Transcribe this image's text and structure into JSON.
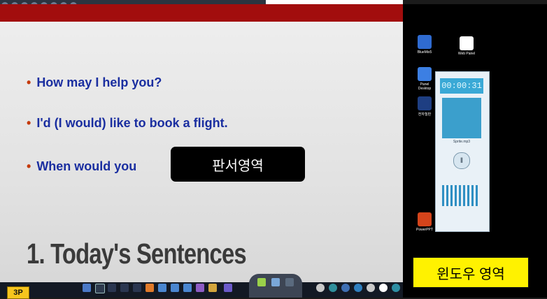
{
  "slide": {
    "bullets": [
      "How may I help you?",
      "I'd (I would) like to book a flight.",
      "When would you"
    ],
    "bullet_marker": "•",
    "title": "1. Today's Sentences",
    "page_badge": "3P"
  },
  "overlays": {
    "board_area": "판서영역",
    "window_area": "윈도우 영역"
  },
  "desktop": {
    "icons": [
      {
        "label": "BlueMix5",
        "icon": "app-icon"
      },
      {
        "label": "Web Panel",
        "icon": "document-icon"
      },
      {
        "label": "Panel Desktop",
        "icon": "app-icon"
      },
      {
        "label": "전자칠판",
        "icon": "star-icon"
      },
      {
        "label": "PowerPPT",
        "icon": "powerpoint-icon"
      }
    ]
  },
  "player": {
    "time": "00:00:31",
    "track": "Sprite.mp3",
    "play_glyph": "‖"
  },
  "colors": {
    "slide_accent": "#a20d0d",
    "bullet_text": "#1a2ea0",
    "bullet_dot": "#c53a0b",
    "page_badge": "#f7c51e",
    "window_overlay": "#fff200"
  }
}
